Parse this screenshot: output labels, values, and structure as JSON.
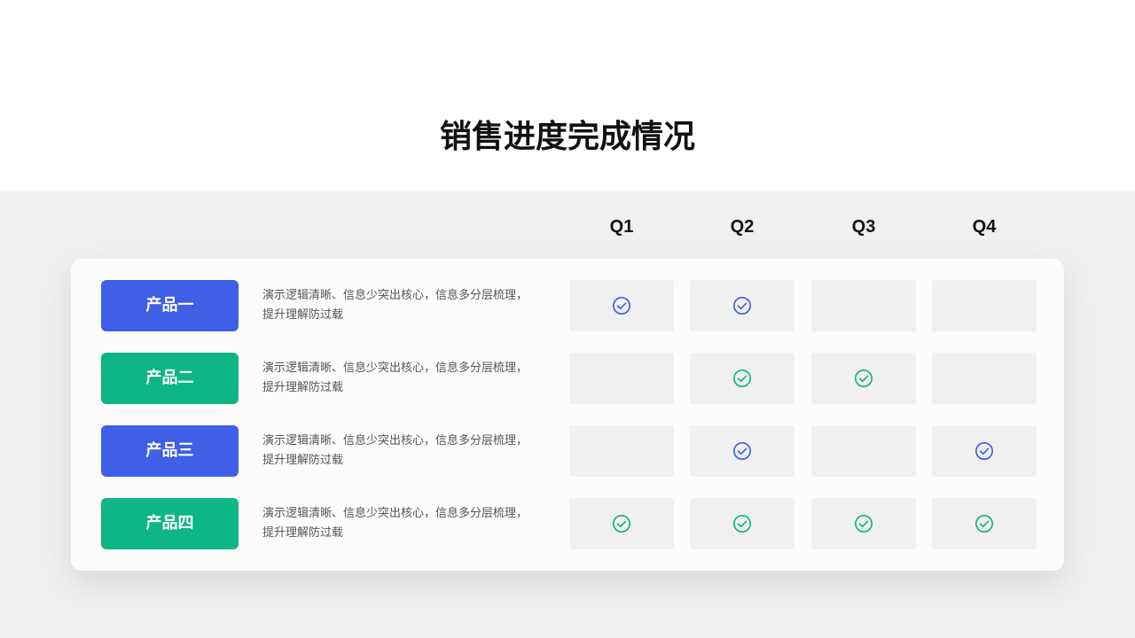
{
  "slide": {
    "title": "销售进度完成情况"
  },
  "quarters": [
    "Q1",
    "Q2",
    "Q3",
    "Q4"
  ],
  "rows": [
    {
      "label": "产品一",
      "desc_line1": "演示逻辑清晰、信息少突出核心，信息多分层梳理，",
      "desc_line2": "提升理解防过载",
      "color": "#3e5fe6",
      "checks": [
        true,
        true,
        false,
        false
      ]
    },
    {
      "label": "产品二",
      "desc_line1": "演示逻辑清晰、信息少突出核心，信息多分层梳理，",
      "desc_line2": "提升理解防过载",
      "color": "#0db684",
      "checks": [
        false,
        true,
        true,
        false
      ]
    },
    {
      "label": "产品三",
      "desc_line1": "演示逻辑清晰、信息少突出核心，信息多分层梳理，",
      "desc_line2": "提升理解防过载",
      "color": "#3e5fe6",
      "checks": [
        false,
        true,
        false,
        true
      ]
    },
    {
      "label": "产品四",
      "desc_line1": "演示逻辑清晰、信息少突出核心，信息多分层梳理，",
      "desc_line2": "提升理解防过载",
      "color": "#0db684",
      "checks": [
        true,
        true,
        true,
        true
      ]
    }
  ],
  "icons": {
    "check": "check-circle-icon"
  },
  "colors": {
    "blue": "#3e5fe6",
    "green": "#0db684",
    "cell_background": "#f0f0f0",
    "content_background": "#f0f0f0"
  }
}
